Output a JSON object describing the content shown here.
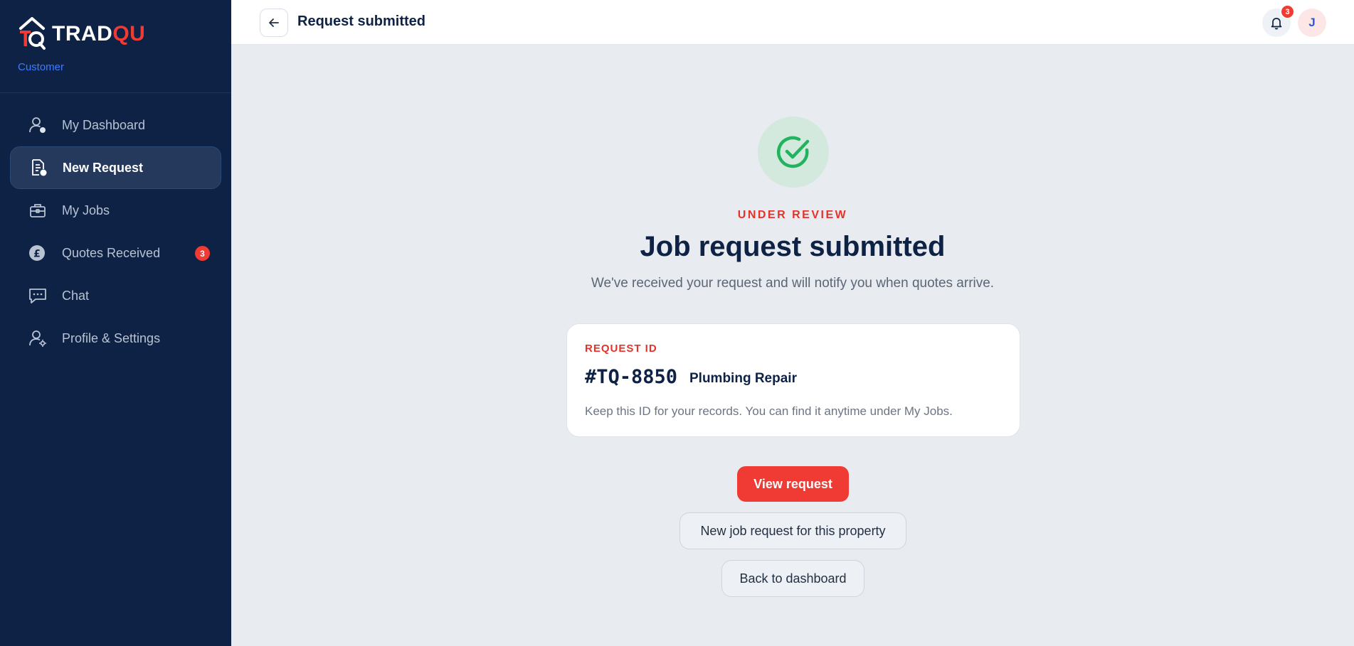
{
  "brand": {
    "name_part1": "TRAD",
    "name_part2": "QU",
    "role": "Customer",
    "logo_letters": "TQ"
  },
  "nav": {
    "items": [
      {
        "label": "My Dashboard",
        "icon": "user-dashboard-icon"
      },
      {
        "label": "New Request",
        "icon": "document-new-icon",
        "active": true
      },
      {
        "label": "My Jobs",
        "icon": "briefcase-icon"
      },
      {
        "label": "Quotes Received",
        "icon": "pound-coin-icon",
        "badge": "3"
      },
      {
        "label": "Chat",
        "icon": "chat-bubble-icon"
      },
      {
        "label": "Profile & Settings",
        "icon": "user-settings-icon"
      }
    ]
  },
  "topbar": {
    "title": "Request submitted",
    "notification_count": "3",
    "avatar_initial": "J"
  },
  "main": {
    "status": "UNDER REVIEW",
    "headline": "Job request submitted",
    "subtext": "We've received your request and will notify you when quotes arrive.",
    "card": {
      "label": "REQUEST ID",
      "id": "#TQ-8850",
      "type": "Plumbing Repair",
      "note": "Keep this ID for your records. You can find it anytime under My Jobs."
    },
    "buttons": {
      "view": "View request",
      "new_request": "New job request for this property",
      "back": "Back to dashboard"
    }
  },
  "colors": {
    "sidebar": "#0d2244",
    "accent": "#ef3b33",
    "success": "#22b35e",
    "role": "#3d7bff"
  }
}
